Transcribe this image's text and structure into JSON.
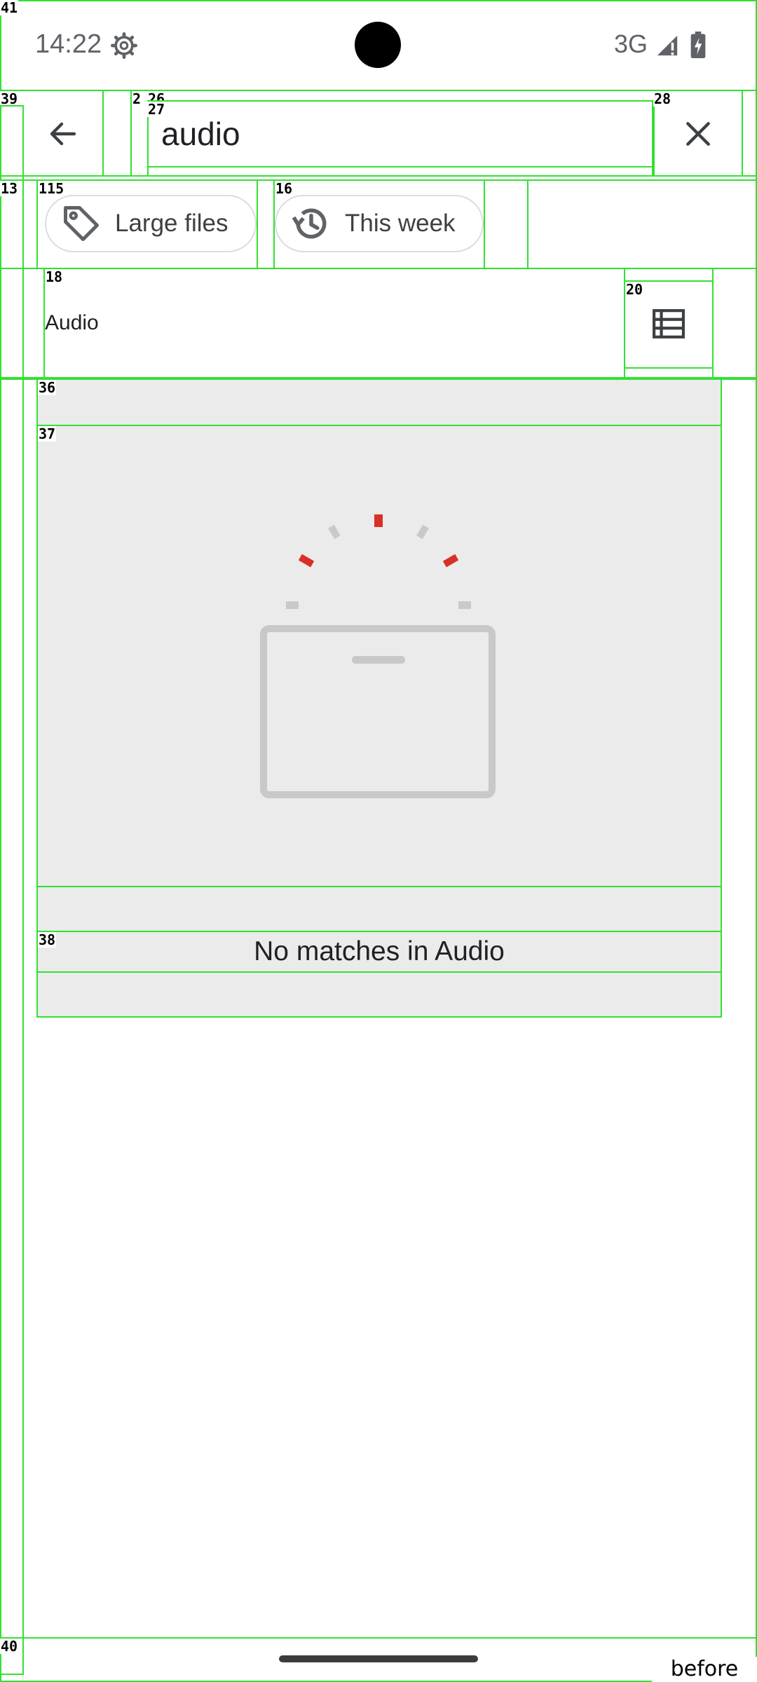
{
  "status_bar": {
    "time": "14:22",
    "network": "3G",
    "icons": [
      "settings-icon",
      "signal-icon",
      "battery-charging-icon"
    ]
  },
  "search": {
    "value": "audio",
    "back_icon": "arrow-left-icon",
    "clear_icon": "close-icon"
  },
  "chips": [
    {
      "label": "Large files",
      "icon": "tag-icon"
    },
    {
      "label": "This week",
      "icon": "history-icon"
    }
  ],
  "filter": {
    "label": "Audio",
    "view_icon": "list-view-icon"
  },
  "empty_state": {
    "message": "No matches in Audio",
    "illustration": "empty-box-icon"
  },
  "overlay_tags": {
    "root": "41",
    "statusbar_container": "39",
    "search_container_a": "2",
    "search_container_b": "26",
    "search_input": "27",
    "clear_button": "28",
    "chip_row": "13",
    "chip_large": "115",
    "chip_week": "16",
    "filter_label": "18",
    "view_toggle": "20",
    "empty_outer": "36",
    "empty_image": "37",
    "empty_text": "38",
    "nav_bar": "40",
    "caption": "before"
  },
  "colors": {
    "accent_red": "#d93025",
    "outline": "#33e033",
    "empty_bg": "#ebebeb"
  }
}
